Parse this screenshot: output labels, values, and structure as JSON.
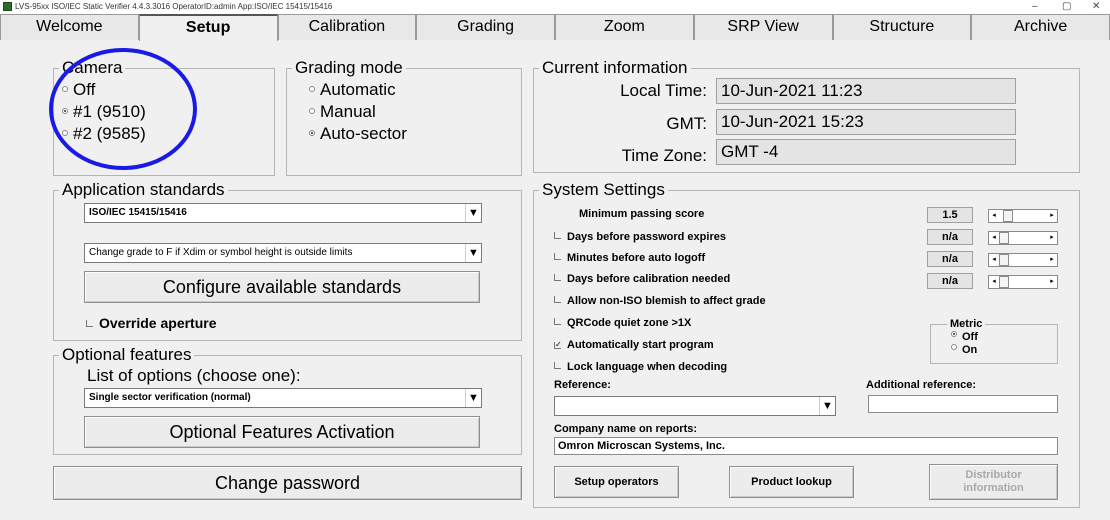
{
  "window": {
    "title": "LVS-95xx ISO/IEC Static Verifier 4.4.3.3016   OperatorID:admin   App:ISO/IEC 15415/15416",
    "minimize": "–",
    "maximize": "▢",
    "close": "✕"
  },
  "tabs": [
    "Welcome",
    "Setup",
    "Calibration",
    "Grading",
    "Zoom",
    "SRP View",
    "Structure",
    "Archive"
  ],
  "camera": {
    "title": "Camera",
    "options": [
      "Off",
      "#1 (9510)",
      "#2 (9585)"
    ],
    "selected": "#1 (9510)"
  },
  "grading_mode": {
    "title": "Grading mode",
    "options": [
      "Automatic",
      "Manual",
      "Auto-sector"
    ],
    "selected": "Auto-sector"
  },
  "current_info": {
    "title": "Current information",
    "local_time_label": "Local Time:",
    "local_time": "10-Jun-2021 11:23",
    "gmt_label": "GMT:",
    "gmt": "10-Jun-2021 15:23",
    "timezone_label": "Time Zone:",
    "timezone": "GMT -4"
  },
  "app_standards": {
    "title": "Application standards",
    "standard_value": "ISO/IEC 15415/15416",
    "grade_rule_value": "Change grade to F if Xdim or symbol height is outside limits",
    "configure_button": "Configure available standards",
    "override_aperture": "Override aperture"
  },
  "optional_features": {
    "title": "Optional features",
    "list_label": "List of options (choose one):",
    "selected_option": "Single sector verification (normal)",
    "activation_button": "Optional Features Activation"
  },
  "change_password_button": "Change password",
  "system_settings": {
    "title": "System Settings",
    "min_passing_label": "Minimum passing score",
    "min_passing_value": "1.5",
    "password_label": "Days before password expires",
    "password_value": "n/a",
    "logoff_label": "Minutes before auto logoff",
    "logoff_value": "n/a",
    "calibration_label": "Days before calibration needed",
    "calibration_value": "n/a",
    "blemish_label": "Allow non-ISO blemish to affect grade",
    "qrcode_label": "QRCode quiet zone >1X",
    "autostart_label": "Automatically start program",
    "lock_language_label": "Lock language when decoding",
    "metric_title": "Metric",
    "metric_options": [
      "Off",
      "On"
    ],
    "metric_selected": "Off",
    "reference_label": "Reference:",
    "reference_value": "",
    "additional_reference_label": "Additional reference:",
    "additional_reference_value": "",
    "company_label": "Company name on reports:",
    "company_value": "Omron Microscan Systems, Inc.",
    "setup_operators_button": "Setup operators",
    "product_lookup_button": "Product lookup",
    "distributor_button_line1": "Distributor",
    "distributor_button_line2": "information"
  },
  "checkboxes": {
    "password_checked": false,
    "logoff_checked": false,
    "calibration_checked": false,
    "blemish_checked": false,
    "qrcode_checked": false,
    "autostart_checked": true,
    "lock_language_checked": false,
    "override_aperture_checked": false
  },
  "colors": {
    "annotation_circle": "#1a1ae6",
    "background": "#f0f0f0"
  }
}
